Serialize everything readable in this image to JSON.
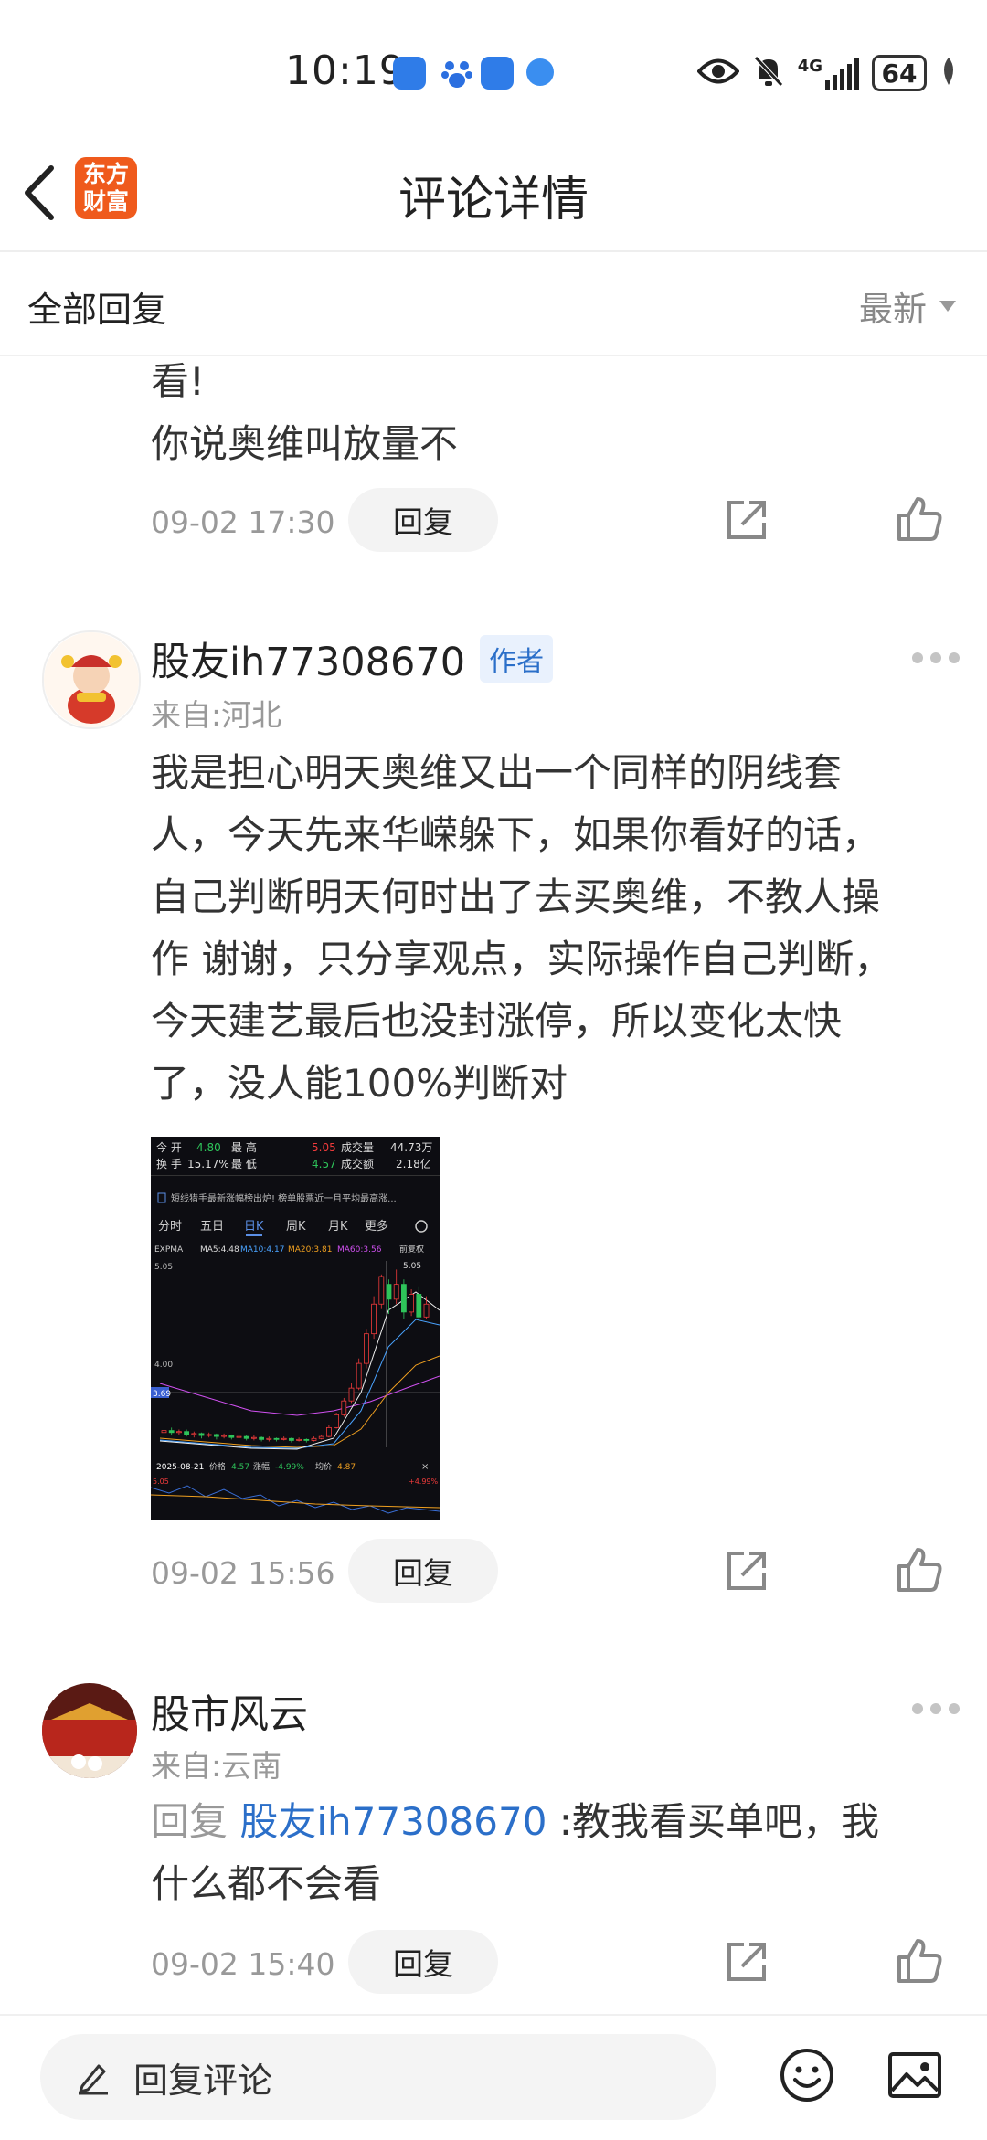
{
  "status_bar": {
    "time": "10:19",
    "network": "4G",
    "battery": "64"
  },
  "header": {
    "title": "评论详情",
    "logo_line1": "东方",
    "logo_line2": "财富"
  },
  "filter": {
    "label": "全部回复",
    "sort": "最新"
  },
  "comments": [
    {
      "text_lines": [
        "看!",
        "你说奥维叫放量不"
      ],
      "time": "09-02 17:30",
      "reply_label": "回复"
    },
    {
      "username": "股友ih77308670",
      "badge": "作者",
      "location": "来自:河北",
      "text_lines": [
        "我是担心明天奥维又出一个同样的阴线套",
        "人，今天先来华嵘躲下，如果你看好的话，",
        "自己判断明天何时出了去买奥维，不教人操",
        "作 谢谢，只分享观点，实际操作自己判断，",
        "今天建艺最后也没封涨停，所以变化太快",
        "了，没人能100%判断对"
      ],
      "time": "09-02 15:56",
      "reply_label": "回复"
    },
    {
      "username": "股市风云",
      "location": "来自:云南",
      "reply_prefix": "回复",
      "mention": "股友ih77308670",
      "text_after_mention": ":教我看买单吧，我",
      "text_line2": "什么都不会看",
      "time": "09-02 15:40",
      "reply_label": "回复"
    }
  ],
  "stock_image": {
    "row1": [
      "今 开",
      "4.80",
      "最 高",
      "5.05",
      "成交量",
      "44.73万"
    ],
    "row2": [
      "换 手",
      "15.17%",
      "最 低",
      "4.57",
      "成交额",
      "2.18亿"
    ],
    "banner": "短线猎手最新涨幅榜出炉! 榜单股票近一月平均最高涨...",
    "tabs": [
      "分时",
      "五日",
      "日K",
      "周K",
      "月K",
      "更多"
    ],
    "ma_line": [
      "EXPMA",
      "MA5:4.48",
      "MA10:4.17",
      "MA20:3.81",
      "MA60:3.56",
      "前复权"
    ],
    "y_labels": [
      "5.05",
      "4.00",
      "3.69"
    ],
    "peak_label": "5.05",
    "footer": [
      "2025-08-21",
      "价格",
      "4.57",
      "涨幅",
      "-4.99%",
      "均价",
      "4.87"
    ],
    "footer_right": "+4.99%",
    "footer_left": "5.05",
    "candles": [
      {
        "o": 3.4,
        "c": 3.42,
        "h": 3.45,
        "l": 3.38
      },
      {
        "o": 3.42,
        "c": 3.4,
        "h": 3.45,
        "l": 3.37
      },
      {
        "o": 3.4,
        "c": 3.41,
        "h": 3.43,
        "l": 3.38
      },
      {
        "o": 3.41,
        "c": 3.38,
        "h": 3.43,
        "l": 3.36
      },
      {
        "o": 3.38,
        "c": 3.39,
        "h": 3.41,
        "l": 3.35
      },
      {
        "o": 3.39,
        "c": 3.37,
        "h": 3.4,
        "l": 3.34
      },
      {
        "o": 3.37,
        "c": 3.38,
        "h": 3.4,
        "l": 3.35
      },
      {
        "o": 3.38,
        "c": 3.36,
        "h": 3.39,
        "l": 3.33
      },
      {
        "o": 3.36,
        "c": 3.37,
        "h": 3.39,
        "l": 3.34
      },
      {
        "o": 3.37,
        "c": 3.35,
        "h": 3.38,
        "l": 3.33
      },
      {
        "o": 3.35,
        "c": 3.36,
        "h": 3.38,
        "l": 3.33
      },
      {
        "o": 3.36,
        "c": 3.34,
        "h": 3.37,
        "l": 3.32
      },
      {
        "o": 3.34,
        "c": 3.35,
        "h": 3.37,
        "l": 3.32
      },
      {
        "o": 3.35,
        "c": 3.33,
        "h": 3.36,
        "l": 3.31
      },
      {
        "o": 3.33,
        "c": 3.34,
        "h": 3.36,
        "l": 3.31
      },
      {
        "o": 3.34,
        "c": 3.33,
        "h": 3.35,
        "l": 3.31
      },
      {
        "o": 3.33,
        "c": 3.34,
        "h": 3.36,
        "l": 3.32
      },
      {
        "o": 3.34,
        "c": 3.32,
        "h": 3.35,
        "l": 3.3
      },
      {
        "o": 3.32,
        "c": 3.33,
        "h": 3.35,
        "l": 3.31
      },
      {
        "o": 3.33,
        "c": 3.32,
        "h": 3.34,
        "l": 3.3
      },
      {
        "o": 3.32,
        "c": 3.34,
        "h": 3.36,
        "l": 3.31
      },
      {
        "o": 3.34,
        "c": 3.36,
        "h": 3.38,
        "l": 3.33
      },
      {
        "o": 3.36,
        "c": 3.45,
        "h": 3.48,
        "l": 3.35
      },
      {
        "o": 3.45,
        "c": 3.58,
        "h": 3.6,
        "l": 3.44
      },
      {
        "o": 3.58,
        "c": 3.72,
        "h": 3.75,
        "l": 3.56
      },
      {
        "o": 3.72,
        "c": 3.85,
        "h": 3.9,
        "l": 3.7
      },
      {
        "o": 3.85,
        "c": 4.1,
        "h": 4.15,
        "l": 3.83
      },
      {
        "o": 4.1,
        "c": 4.4,
        "h": 4.45,
        "l": 4.05
      },
      {
        "o": 4.4,
        "c": 4.7,
        "h": 4.78,
        "l": 4.35
      },
      {
        "o": 4.7,
        "c": 4.98,
        "h": 5.0,
        "l": 4.65
      },
      {
        "o": 4.9,
        "c": 4.75,
        "h": 4.95,
        "l": 4.6
      },
      {
        "o": 4.75,
        "c": 4.9,
        "h": 5.05,
        "l": 4.7
      },
      {
        "o": 4.9,
        "c": 4.62,
        "h": 4.95,
        "l": 4.55
      },
      {
        "o": 4.62,
        "c": 4.8,
        "h": 4.85,
        "l": 4.58
      },
      {
        "o": 4.8,
        "c": 4.57,
        "h": 4.88,
        "l": 4.52
      },
      {
        "o": 4.57,
        "c": 4.7,
        "h": 4.78,
        "l": 4.55
      }
    ]
  },
  "bottom_bar": {
    "placeholder": "回复评论"
  }
}
